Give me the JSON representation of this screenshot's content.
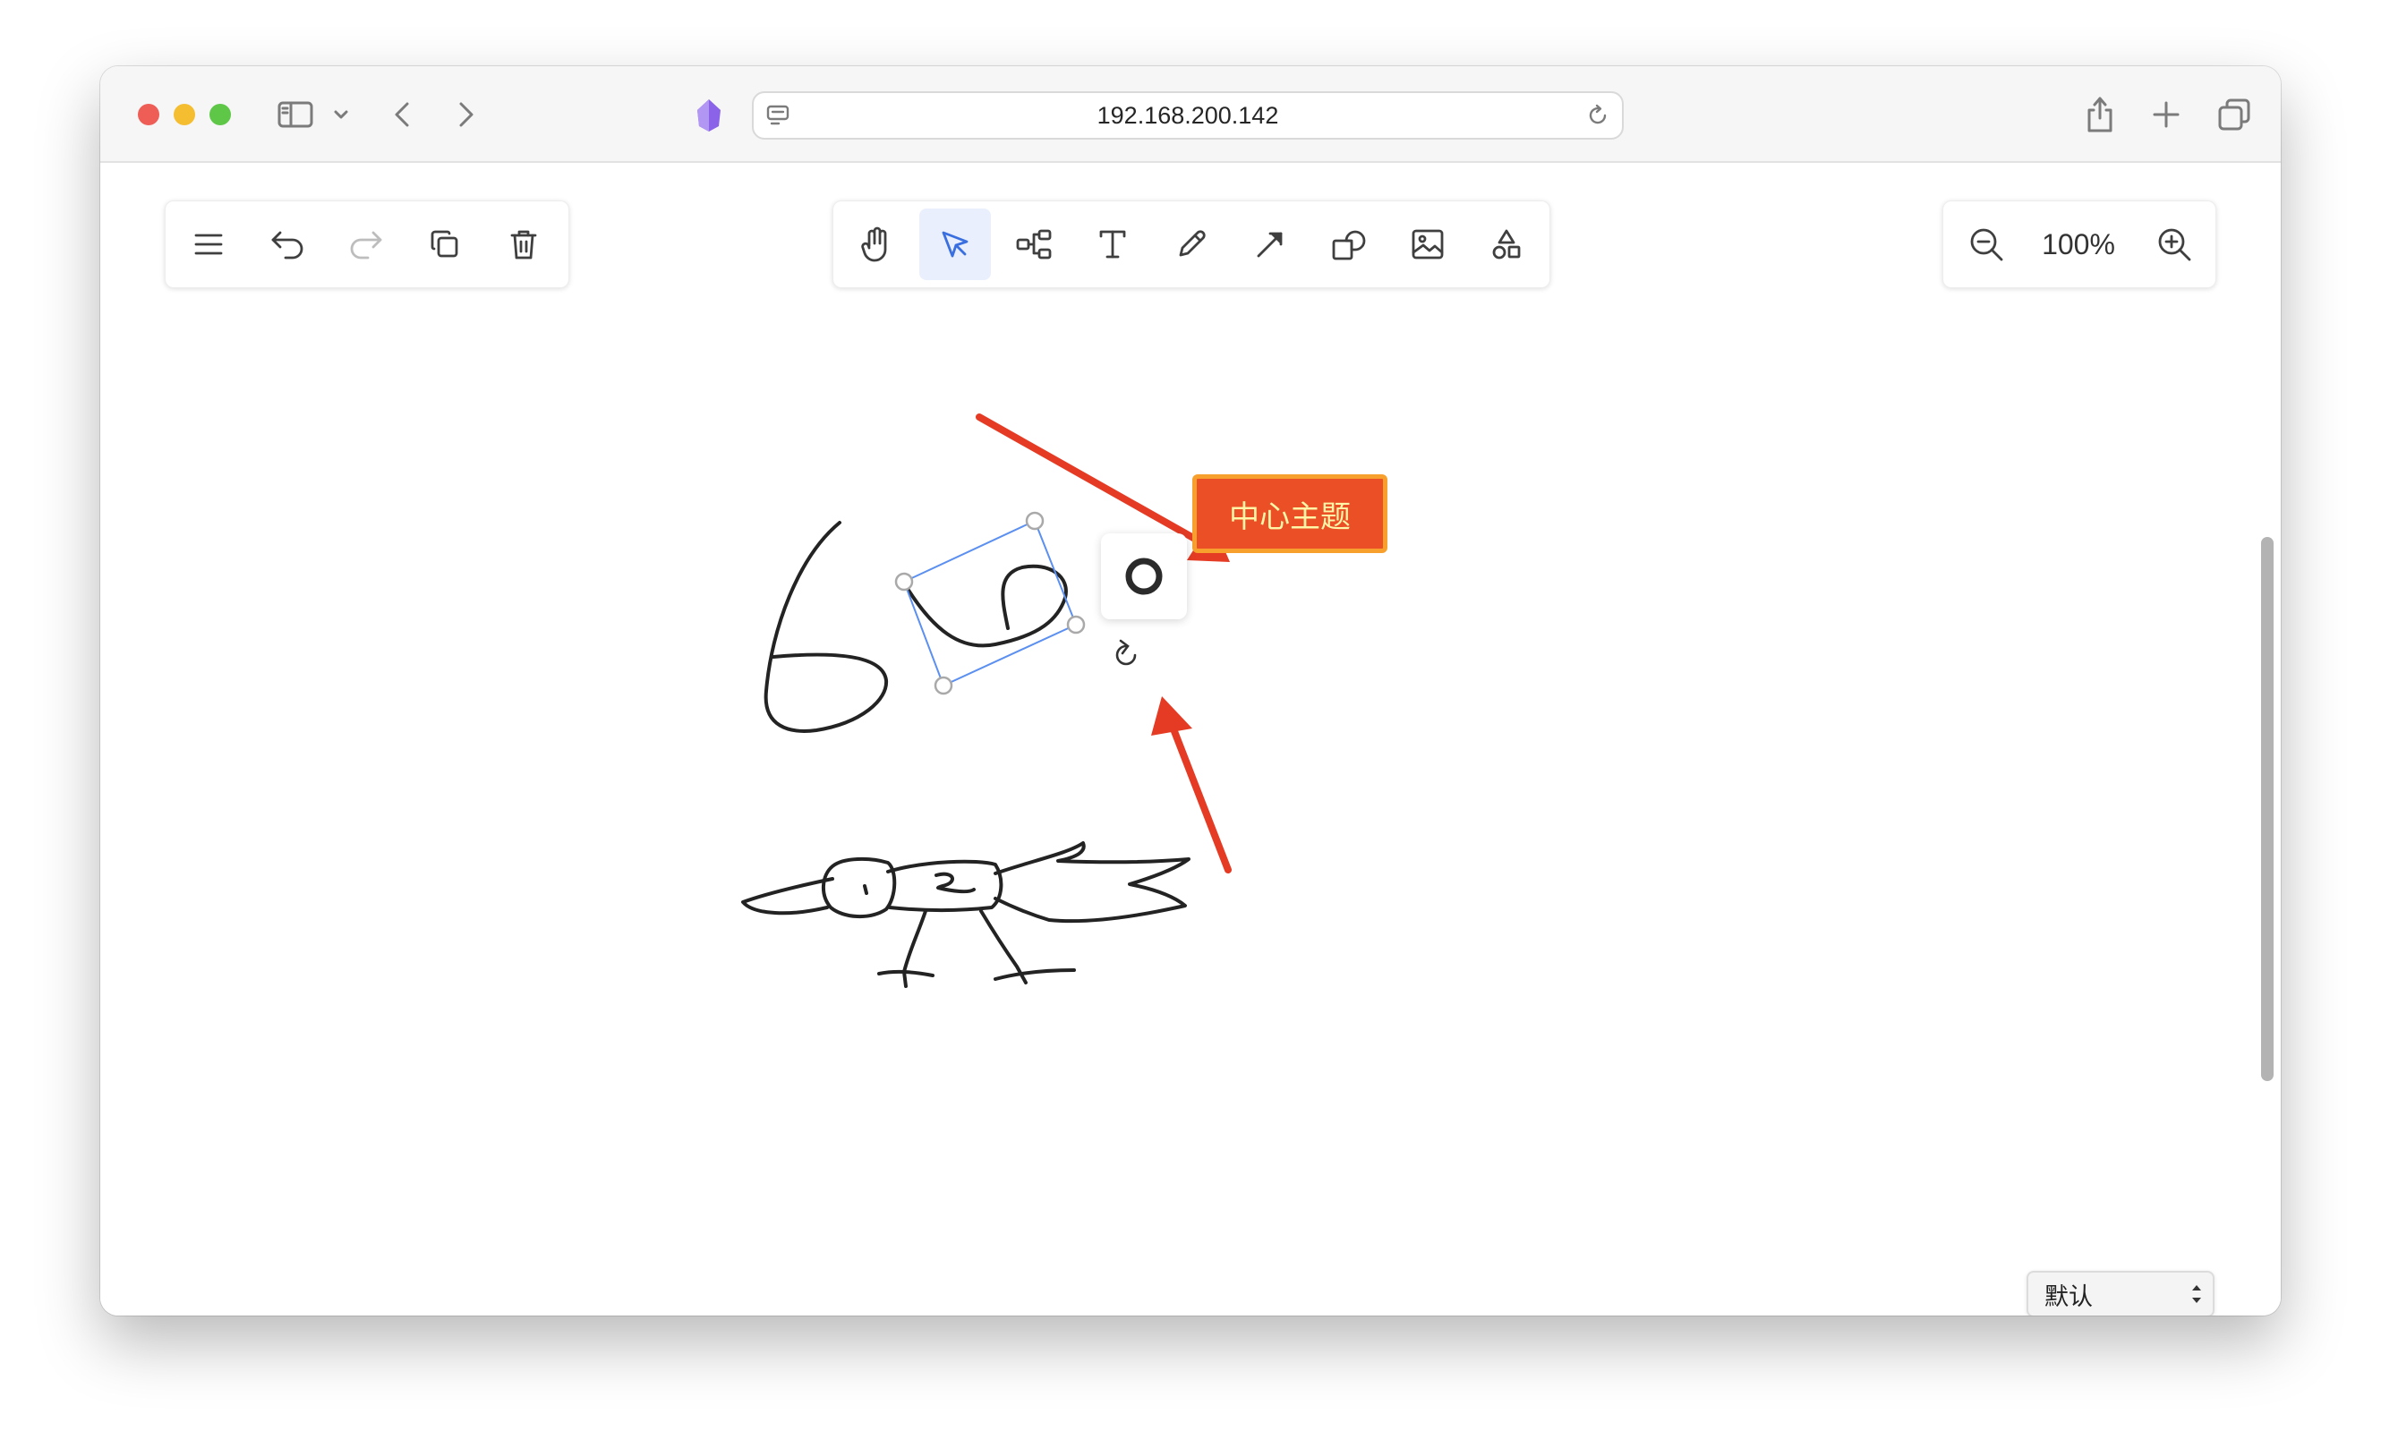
{
  "browser": {
    "url": "192.168.200.142",
    "icons": [
      "sidebar-icon",
      "chevron-down-icon",
      "back-icon",
      "forward-icon",
      "app-logo-icon",
      "page-icon",
      "reload-icon",
      "share-icon",
      "new-tab-icon",
      "tabs-overview-icon"
    ]
  },
  "left_toolbar": {
    "icons": [
      "menu-icon",
      "undo-icon",
      "redo-icon",
      "duplicate-icon",
      "delete-icon"
    ]
  },
  "main_toolbar": {
    "active": "select-tool",
    "tools": [
      "hand-tool",
      "select-tool",
      "mindmap-tool",
      "text-tool",
      "pen-tool",
      "arrow-tool",
      "shape-tool",
      "image-tool",
      "more-shapes-tool"
    ]
  },
  "zoom": {
    "value": "100%"
  },
  "canvas": {
    "topic_node_text": "中心主题",
    "selection_color": "#5b8ff0",
    "annotation_color": "#e53b24"
  },
  "theme_select": {
    "value": "默认"
  },
  "colors": {
    "topic_fill": "#ea4f25",
    "topic_border": "#f7a02e",
    "topic_text": "#fff6a8",
    "active_tool_bg": "#e9effd"
  }
}
